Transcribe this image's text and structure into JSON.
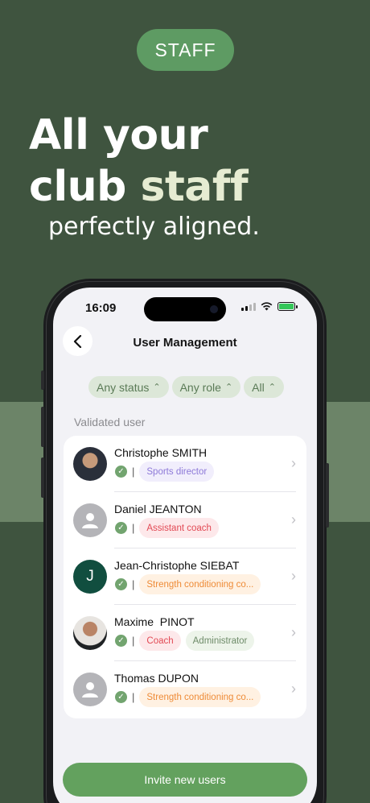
{
  "badge": "STAFF",
  "headline": {
    "line1": "All your",
    "line2_prefix": "club ",
    "line2_accent": "staff",
    "sub": "perfectly aligned."
  },
  "status_bar": {
    "time": "16:09"
  },
  "screen": {
    "title": "User Management",
    "filters": [
      {
        "label": "Any status"
      },
      {
        "label": "Any role"
      },
      {
        "label": "All"
      }
    ],
    "section_label": "Validated user",
    "users": [
      {
        "name": "Christophe SMITH",
        "tags": [
          "Sports director"
        ],
        "avatar": "photo"
      },
      {
        "name": "Daniel JEANTON",
        "tags": [
          "Assistant coach"
        ],
        "avatar": "placeholder"
      },
      {
        "name": "Jean-Christophe SIEBAT",
        "tags": [
          "Strength conditioning co..."
        ],
        "avatar": "initial",
        "initial": "J"
      },
      {
        "name": "Maxime  PINOT",
        "tags": [
          "Coach",
          "Administrator"
        ],
        "avatar": "photo"
      },
      {
        "name": "Thomas DUPON",
        "tags": [
          "Strength conditioning co..."
        ],
        "avatar": "placeholder"
      }
    ],
    "invite_button": "Invite new users"
  },
  "colors": {
    "background": "#3f543f",
    "accent": "#63a15e",
    "badge": "#5e9b63"
  }
}
